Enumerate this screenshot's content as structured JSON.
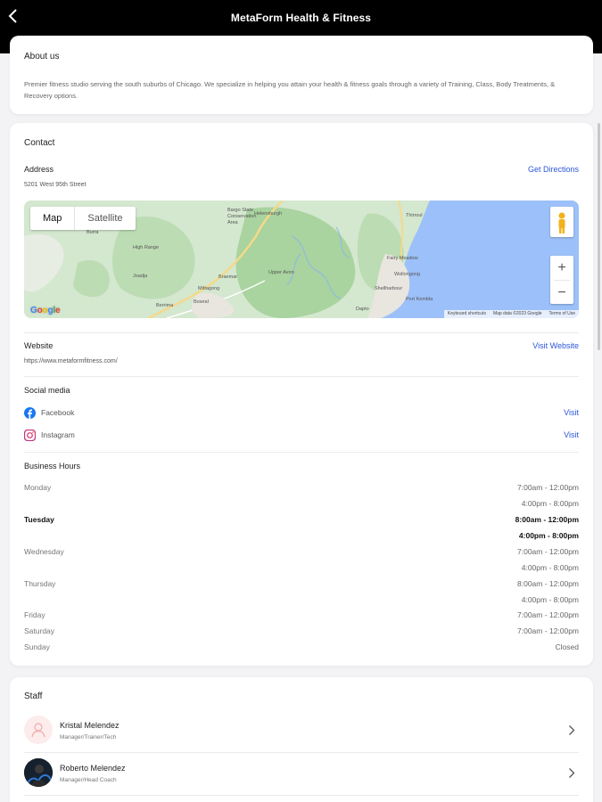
{
  "header": {
    "title": "MetaForm Health & Fitness"
  },
  "about": {
    "heading": "About us",
    "text": "Premier fitness studio serving the south suburbs of Chicago. We specialize in helping you attain your health & fitness goals through a variety of Training, Class, Body Treatments, & Recovery options."
  },
  "contact": {
    "heading": "Contact",
    "address_label": "Address",
    "address": "5201 West 95th Street",
    "directions_link": "Get Directions",
    "map": {
      "tab_map": "Map",
      "tab_satellite": "Satellite",
      "zoom_in": "+",
      "zoom_out": "−",
      "logo_letters": [
        "G",
        "o",
        "o",
        "g",
        "l",
        "e"
      ],
      "attrib_shortcuts": "Keyboard shortcuts",
      "attrib_data": "Map data ©2023 Google",
      "attrib_terms": "Terms of Use",
      "places": {
        "bargo": "Bargo State\nConservation\nArea",
        "helensburgh": "Helensburgh",
        "high_range": "High Range",
        "joadja": "Joadja",
        "upper_avon": "Upper Avon",
        "bowral": "Bowral",
        "berrima": "Berrima",
        "mittagong": "Mittagong",
        "braemar": "Braemar",
        "fairy_meadow": "Fairy Meadow",
        "wollongong": "Wollongong",
        "shellharbour": "Shellharbour",
        "port_kembla": "Port Kembla",
        "dapto": "Dapto",
        "burra": "Burra",
        "thirroul": "Thirroul"
      }
    },
    "website_label": "Website",
    "website_url": "https://www.metaformfitness.com/",
    "website_link": "Visit Website",
    "social_heading": "Social media",
    "social": [
      {
        "name": "Facebook",
        "link": "Visit",
        "icon": "facebook-icon"
      },
      {
        "name": "Instagram",
        "link": "Visit",
        "icon": "instagram-icon"
      }
    ],
    "hours_heading": "Business Hours",
    "hours": [
      {
        "day": "Monday",
        "times": [
          "7:00am - 12:00pm",
          "4:00pm - 8:00pm"
        ],
        "today": false
      },
      {
        "day": "Tuesday",
        "times": [
          "8:00am - 12:00pm",
          "4:00pm - 8:00pm"
        ],
        "today": true
      },
      {
        "day": "Wednesday",
        "times": [
          "7:00am - 12:00pm",
          "4:00pm - 8:00pm"
        ],
        "today": false
      },
      {
        "day": "Thursday",
        "times": [
          "8:00am - 12:00pm",
          "4:00pm - 8:00pm"
        ],
        "today": false
      },
      {
        "day": "Friday",
        "times": [
          "7:00am - 12:00pm"
        ],
        "today": false
      },
      {
        "day": "Saturday",
        "times": [
          "7:00am - 12:00pm"
        ],
        "today": false
      },
      {
        "day": "Sunday",
        "times": [
          "Closed"
        ],
        "today": false
      }
    ]
  },
  "staff": {
    "heading": "Staff",
    "members": [
      {
        "name": "Kristal Melendez",
        "role": "Manager/Trainer/Tech"
      },
      {
        "name": "Roberto Melendez",
        "role": "Manager/Head Coach"
      }
    ]
  },
  "colors": {
    "link": "#2b57d9",
    "topbar": "#000000",
    "water": "#9cc0f9"
  }
}
